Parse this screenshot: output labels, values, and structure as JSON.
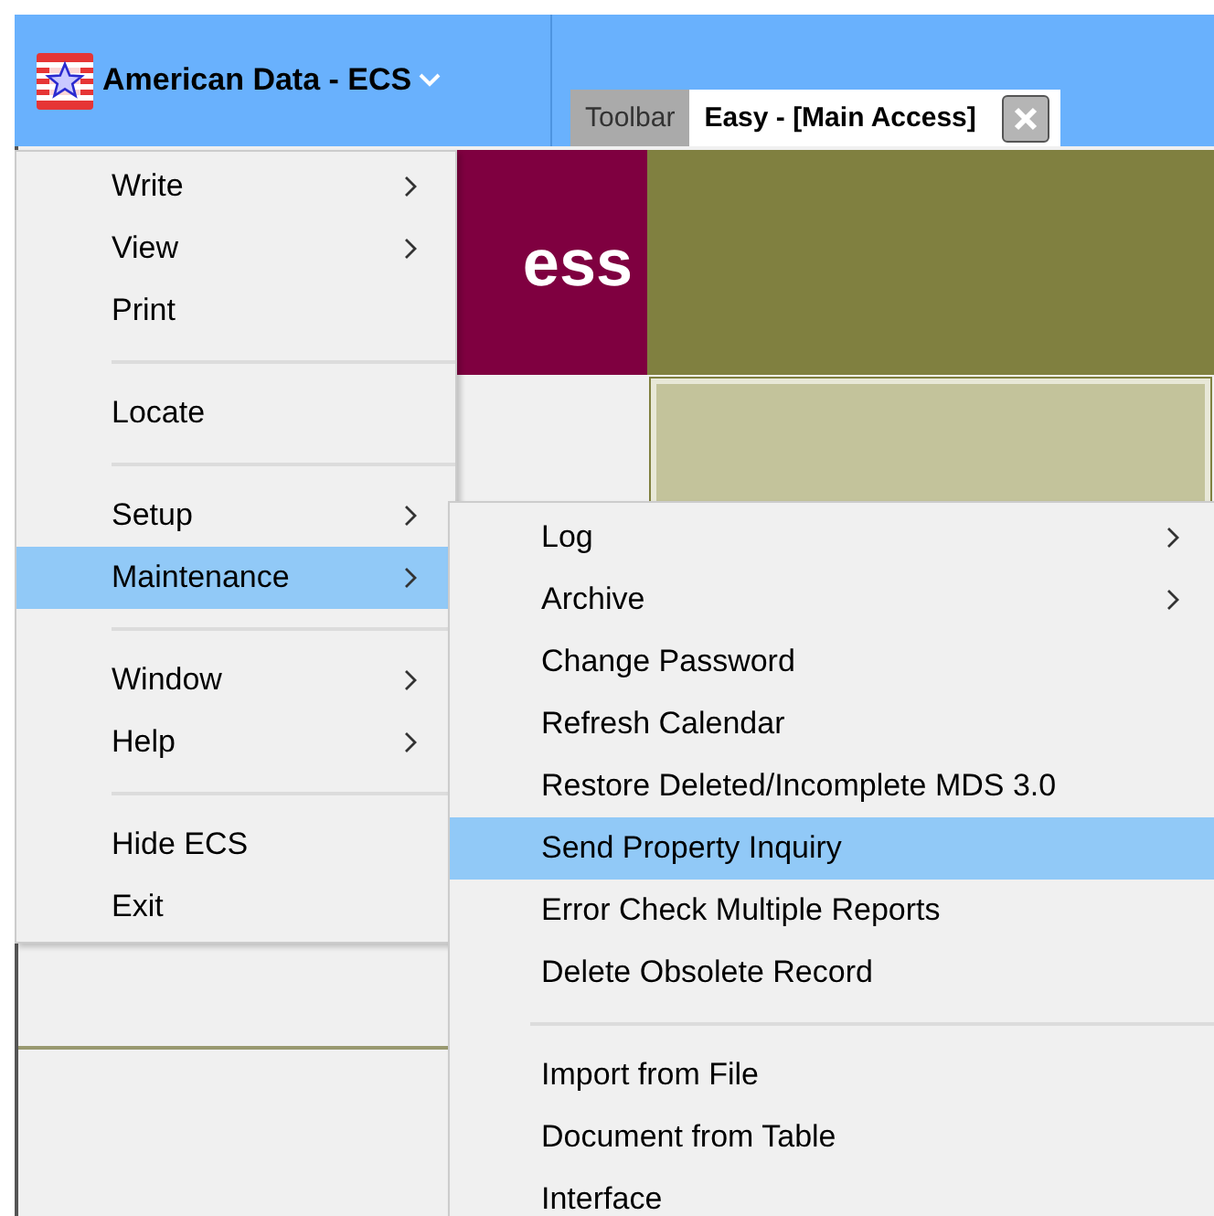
{
  "app": {
    "title": "American Data - ECS"
  },
  "tabs": [
    {
      "label": "Toolbar",
      "selected": false,
      "closable": false
    },
    {
      "label": "Easy - [Main Access]",
      "selected": true,
      "closable": true
    }
  ],
  "banner": {
    "text": "ess"
  },
  "menu": {
    "items": [
      {
        "kind": "item",
        "label": "Write",
        "submenu": true,
        "selected": false
      },
      {
        "kind": "item",
        "label": "View",
        "submenu": true,
        "selected": false
      },
      {
        "kind": "item",
        "label": "Print",
        "submenu": false,
        "selected": false
      },
      {
        "kind": "separator"
      },
      {
        "kind": "item",
        "label": "Locate",
        "submenu": false,
        "selected": false
      },
      {
        "kind": "separator"
      },
      {
        "kind": "item",
        "label": "Setup",
        "submenu": true,
        "selected": false
      },
      {
        "kind": "item",
        "label": "Maintenance",
        "submenu": true,
        "selected": true
      },
      {
        "kind": "separator"
      },
      {
        "kind": "item",
        "label": "Window",
        "submenu": true,
        "selected": false
      },
      {
        "kind": "item",
        "label": "Help",
        "submenu": true,
        "selected": false
      },
      {
        "kind": "separator"
      },
      {
        "kind": "item",
        "label": "Hide ECS",
        "submenu": false,
        "selected": false
      },
      {
        "kind": "item",
        "label": "Exit",
        "submenu": false,
        "selected": false
      }
    ]
  },
  "submenu": {
    "items": [
      {
        "kind": "item",
        "label": "Log",
        "submenu": true,
        "selected": false
      },
      {
        "kind": "item",
        "label": "Archive",
        "submenu": true,
        "selected": false
      },
      {
        "kind": "item",
        "label": "Change Password",
        "submenu": false,
        "selected": false
      },
      {
        "kind": "item",
        "label": "Refresh Calendar",
        "submenu": false,
        "selected": false
      },
      {
        "kind": "item",
        "label": "Restore Deleted/Incomplete MDS 3.0",
        "submenu": false,
        "selected": false
      },
      {
        "kind": "item",
        "label": "Send Property Inquiry",
        "submenu": false,
        "selected": true
      },
      {
        "kind": "item",
        "label": "Error Check Multiple Reports",
        "submenu": false,
        "selected": false
      },
      {
        "kind": "item",
        "label": "Delete Obsolete Record",
        "submenu": false,
        "selected": false
      },
      {
        "kind": "separator"
      },
      {
        "kind": "item",
        "label": "Import from File",
        "submenu": false,
        "selected": false
      },
      {
        "kind": "item",
        "label": "Document from Table",
        "submenu": false,
        "selected": false
      },
      {
        "kind": "item",
        "label": "Interface",
        "submenu": false,
        "selected": false
      }
    ]
  }
}
